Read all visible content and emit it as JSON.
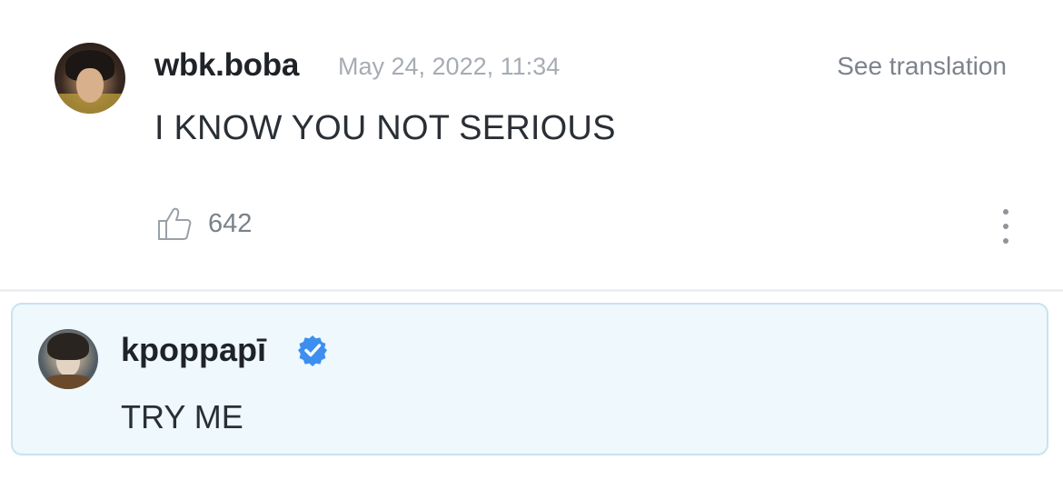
{
  "comment": {
    "username": "wbk.boba",
    "timestamp": "May 24, 2022, 11:34",
    "translate_label": "See translation",
    "text": "I KNOW YOU NOT SERIOUS",
    "like_count": "642",
    "like_icon": "thumbs-up-icon",
    "more_icon": "more-vertical-icon"
  },
  "reply": {
    "username": "kpoppapī",
    "verified_icon": "verified-badge-icon",
    "text": "TRY ME"
  },
  "colors": {
    "reply_background": "#eef8fd",
    "reply_border": "#c9e2ee",
    "verified_blue": "#3d8fef"
  }
}
